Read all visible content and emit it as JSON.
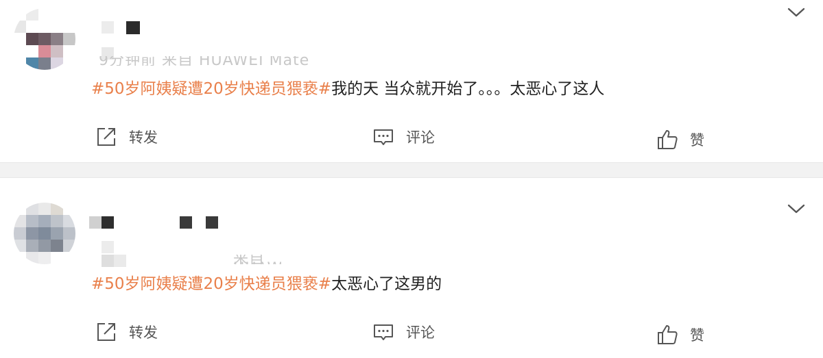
{
  "posts": [
    {
      "meta_blurred": "9分钟前 来自 HUAWEI Mate",
      "topic": "#50岁阿姨疑遭20岁快递员猥亵#",
      "text": "我的天 当众就开始了。。。太恶心了这人",
      "actions": {
        "repost": "转发",
        "comment": "评论",
        "like": "赞"
      }
    },
    {
      "meta_blurred": "来自 HUAWEI Mate",
      "topic": "#50岁阿姨疑遭20岁快递员猥亵#",
      "text": "太恶心了这男的",
      "actions": {
        "repost": "转发",
        "comment": "评论",
        "like": "赞"
      }
    }
  ],
  "colors": {
    "topic": "#e9804b",
    "text": "#222222",
    "action_label": "#555555",
    "separator": "#f2f2f2"
  },
  "icons": [
    "chevron-down-icon",
    "repost-icon",
    "comment-icon",
    "like-icon"
  ]
}
